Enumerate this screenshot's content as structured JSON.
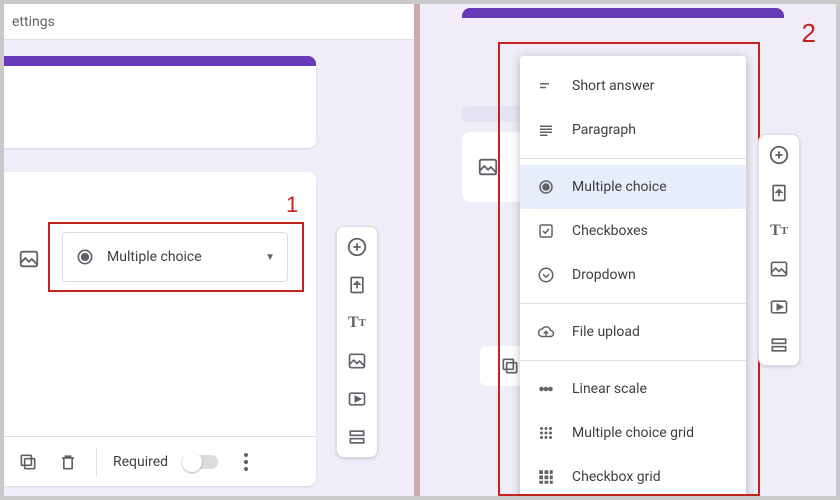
{
  "annotations": {
    "label1": "1",
    "label2": "2"
  },
  "left": {
    "header_crumb": "ettings",
    "dropdown_value": "Multiple choice",
    "footer_required": "Required"
  },
  "side_toolbar": {
    "add": "add-question",
    "import": "import-questions",
    "title": "add-title",
    "image": "add-image",
    "video": "add-video",
    "section": "add-section"
  },
  "menu": {
    "items": [
      {
        "key": "short-answer",
        "label": "Short answer"
      },
      {
        "key": "paragraph",
        "label": "Paragraph"
      },
      {
        "key": "multiple-choice",
        "label": "Multiple choice"
      },
      {
        "key": "checkboxes",
        "label": "Checkboxes"
      },
      {
        "key": "dropdown",
        "label": "Dropdown"
      },
      {
        "key": "file-upload",
        "label": "File upload"
      },
      {
        "key": "linear-scale",
        "label": "Linear scale"
      },
      {
        "key": "mc-grid",
        "label": "Multiple choice grid"
      },
      {
        "key": "checkbox-grid",
        "label": "Checkbox grid"
      }
    ],
    "selected": "multiple-choice"
  }
}
